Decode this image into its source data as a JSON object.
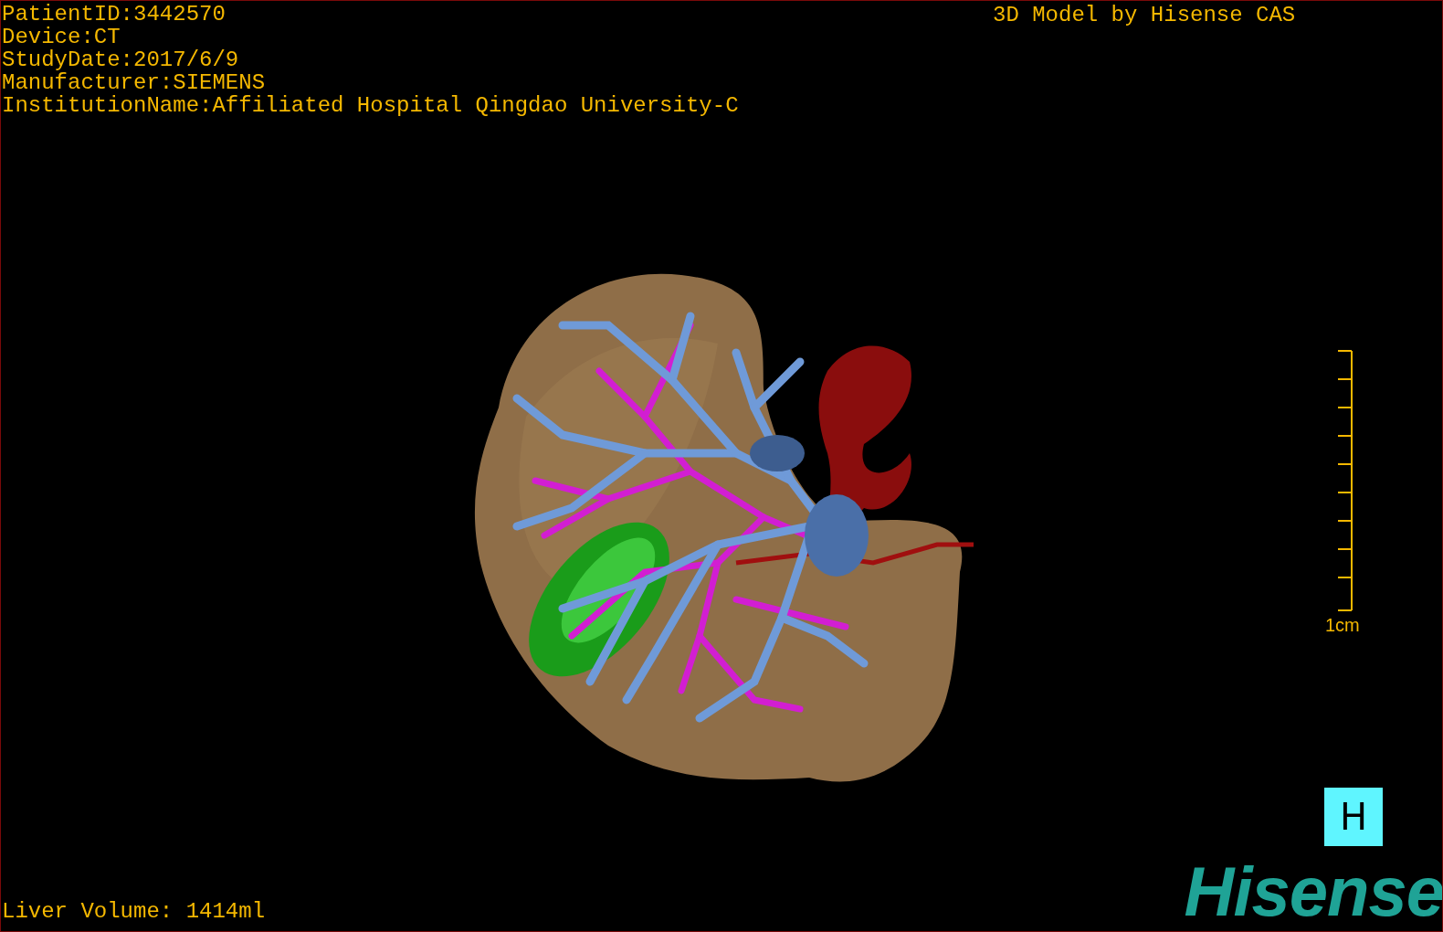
{
  "patient_info": [
    "PatientID:3442570",
    "Device:CT",
    "StudyDate:2017/6/9",
    "Manufacturer:SIEMENS",
    "InstitutionName:Affiliated Hospital Qingdao University-C"
  ],
  "model_caption": "3D Model by Hisense CAS",
  "scale_bar": {
    "label": "1cm"
  },
  "orientation_button": {
    "label": "H"
  },
  "liver_volume": "Liver Volume: 1414ml",
  "logo": "Hisense"
}
